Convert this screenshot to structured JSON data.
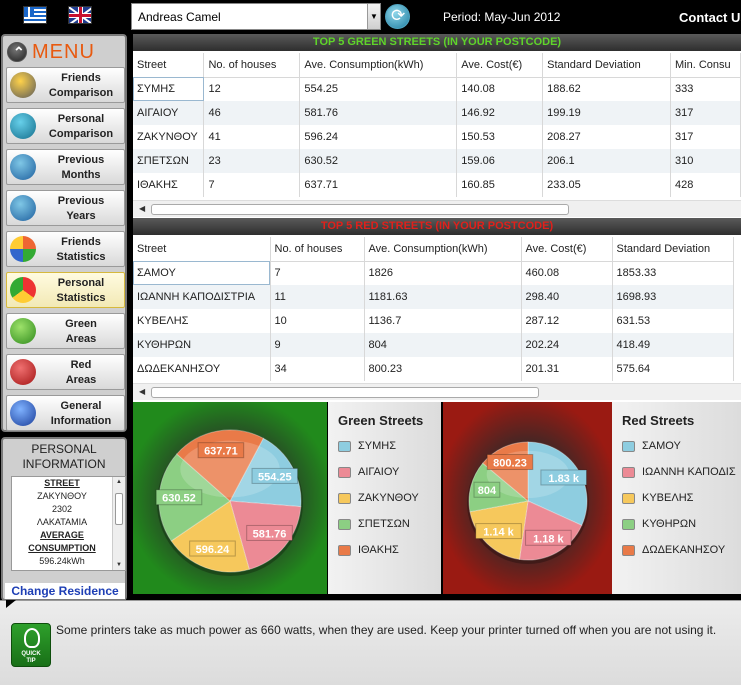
{
  "header": {
    "language_flags": [
      "Greek",
      "English"
    ],
    "user_selected": "Andreas Camel",
    "period": "Period: May-Jun 2012",
    "contact": "Contact Us"
  },
  "sidebar": {
    "menu_title": "MENU",
    "items": [
      {
        "label": "Friends\nComparison",
        "icon": "friends-comparison-icon"
      },
      {
        "label": "Personal\nComparison",
        "icon": "home-icon"
      },
      {
        "label": "Previous\nMonths",
        "icon": "calendar-icon"
      },
      {
        "label": "Previous\nYears",
        "icon": "calendar-icon"
      },
      {
        "label": "Friends\nStatistics",
        "icon": "bar-chart-icon"
      },
      {
        "label": "Personal\nStatistics",
        "icon": "pie-chart-icon"
      },
      {
        "label": "Green\nAreas",
        "icon": "green-leaf-icon"
      },
      {
        "label": "Red\nAreas",
        "icon": "red-leaf-icon"
      },
      {
        "label": "General\nInformation",
        "icon": "info-icon"
      }
    ],
    "personal_info": {
      "title": "PERSONAL\nINFORMATION",
      "street_label": "STREET",
      "street": "ΖΑΚΥΝΘΟΥ",
      "postcode": "2302",
      "city": "ΛΑΚΑΤΑΜΙΑ",
      "avg_label": "AVERAGE\nCONSUMPTION",
      "avg_value": "596.24kWh"
    },
    "change_residence": "Change Residence"
  },
  "green_table": {
    "title": "TOP 5 GREEN STREETS (IN YOUR POSTCODE)",
    "columns": [
      "Street",
      "No. of houses",
      "Ave. Consumption(kWh)",
      "Ave. Cost(€)",
      "Standard Deviation",
      "Min. Consu"
    ],
    "rows": [
      [
        "ΣΥΜΗΣ",
        "12",
        "554.25",
        "140.08",
        "188.62",
        "333"
      ],
      [
        "ΑΙΓΑΙΟΥ",
        "46",
        "581.76",
        "146.92",
        "199.19",
        "317"
      ],
      [
        "ΖΑΚΥΝΘΟΥ",
        "41",
        "596.24",
        "150.53",
        "208.27",
        "317"
      ],
      [
        "ΣΠΕΤΣΩΝ",
        "23",
        "630.52",
        "159.06",
        "206.1",
        "310"
      ],
      [
        "ΙΘΑΚΗΣ",
        "7",
        "637.71",
        "160.85",
        "233.05",
        "428"
      ]
    ]
  },
  "red_table": {
    "title": "TOP 5 RED STREETS (IN YOUR POSTCODE)",
    "columns": [
      "Street",
      "No. of houses",
      "Ave. Consumption(kWh)",
      "Ave. Cost(€)",
      "Standard Deviation"
    ],
    "rows": [
      [
        "ΣΑΜΟΥ",
        "7",
        "1826",
        "460.08",
        "1853.33"
      ],
      [
        "ΙΩΑΝΝΗ ΚΑΠΟΔΙΣΤΡΙΑ",
        "11",
        "1181.63",
        "298.40",
        "1698.93"
      ],
      [
        "ΚΥΒΕΛΗΣ",
        "10",
        "1136.7",
        "287.12",
        "631.53"
      ],
      [
        "ΚΥΘΗΡΩΝ",
        "9",
        "804",
        "202.24",
        "418.49"
      ],
      [
        "ΔΩΔΕΚΑΝΗΣΟΥ",
        "34",
        "800.23",
        "201.31",
        "575.64"
      ]
    ]
  },
  "colors": {
    "slice": [
      "#8ecde0",
      "#ec8a95",
      "#f6c85c",
      "#8ccf83",
      "#e97a48"
    ],
    "green_bg": "#1e8a1a",
    "red_bg": "#951810",
    "green_title": "#5fd42a",
    "red_title": "#e0201b",
    "menu_title": "#e85a10"
  },
  "chart_data": [
    {
      "type": "pie",
      "title": "Green Streets",
      "categories": [
        "ΣΥΜΗΣ",
        "ΑΙΓΑΙΟΥ",
        "ΖΑΚΥΝΘΟΥ",
        "ΣΠΕΤΣΩΝ",
        "ΙΘΑΚΗΣ"
      ],
      "values": [
        554.25,
        581.76,
        596.24,
        630.52,
        637.71
      ],
      "labels": [
        "554.25",
        "581.76",
        "596.24",
        "630.52",
        "637.71"
      ]
    },
    {
      "type": "pie",
      "title": "Red Streets",
      "categories": [
        "ΣΑΜΟΥ",
        "ΙΩΑΝΝΗ ΚΑΠΟΔΙΣΤΡΙΑ",
        "ΚΥΒΕΛΗΣ",
        "ΚΥΘΗΡΩΝ",
        "ΔΩΔΕΚΑΝΗΣΟΥ"
      ],
      "legend_labels": [
        "ΣΑΜΟΥ",
        "ΙΩΑΝΝΗ ΚΑΠΟΔΙΣ",
        "ΚΥΒΕΛΗΣ",
        "ΚΥΘΗΡΩΝ",
        "ΔΩΔΕΚΑΝΗΣΟΥ"
      ],
      "values": [
        1826,
        1181.63,
        1136.7,
        804,
        800.23
      ],
      "labels": [
        "1.83 k",
        "1.18 k",
        "1.14 k",
        "804",
        "800.23"
      ]
    }
  ],
  "tip": {
    "icon_caption": "QUICK\nTIP",
    "text": "Some printers take as much power as 660 watts, when they are used. Keep your printer turned off when you are not using it."
  }
}
